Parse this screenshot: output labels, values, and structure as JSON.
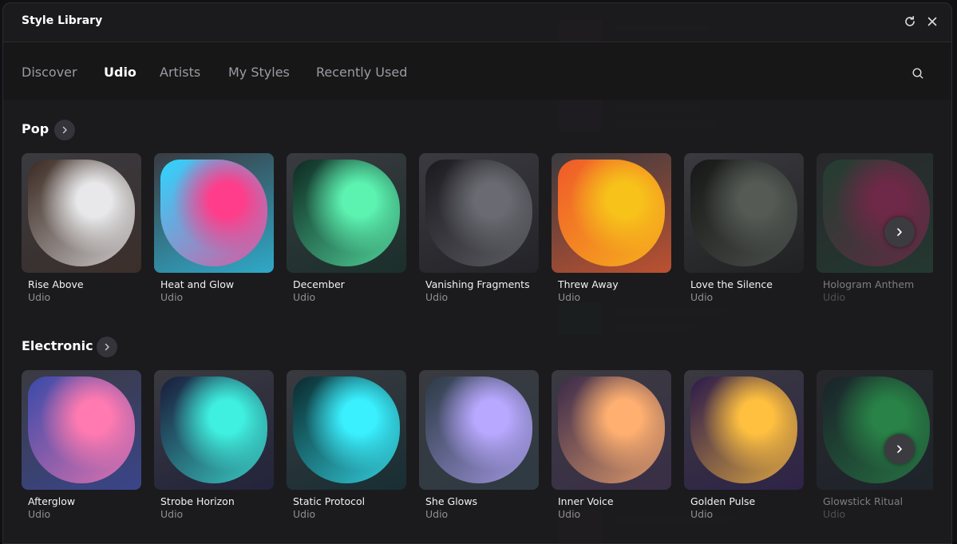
{
  "modal": {
    "title": "Style Library"
  },
  "header_icons": {
    "refresh": "refresh-icon",
    "close": "close-icon"
  },
  "tabs": [
    {
      "label": "Discover",
      "active": false
    },
    {
      "label": "Udio",
      "active": true
    },
    {
      "label": "Artists",
      "active": false
    },
    {
      "label": "My Styles",
      "active": false
    },
    {
      "label": "Recently Used",
      "active": false
    }
  ],
  "sections": [
    {
      "title": "Pop",
      "cards": [
        {
          "name": "Rise Above",
          "sub": "Udio",
          "colors": [
            "#e8e8ea",
            "#3b2a22"
          ]
        },
        {
          "name": "Heat and Glow",
          "sub": "Udio",
          "colors": [
            "#ff3d8a",
            "#2bd6ff"
          ]
        },
        {
          "name": "December",
          "sub": "Udio",
          "colors": [
            "#5cf2b0",
            "#0e2a22"
          ]
        },
        {
          "name": "Vanishing Fragments",
          "sub": "Udio",
          "colors": [
            "#6a6a72",
            "#1a1a1e"
          ]
        },
        {
          "name": "Threw Away",
          "sub": "Udio",
          "colors": [
            "#f7c31a",
            "#f05a2a"
          ]
        },
        {
          "name": "Love the Silence",
          "sub": "Udio",
          "colors": [
            "#555a55",
            "#161716"
          ]
        },
        {
          "name": "Hologram Anthem",
          "sub": "Udio",
          "colors": [
            "#d23a7a",
            "#2a6a4a"
          ]
        }
      ]
    },
    {
      "title": "Electronic",
      "cards": [
        {
          "name": "Afterglow",
          "sub": "Udio",
          "colors": [
            "#ff7ab0",
            "#3a4aa8"
          ]
        },
        {
          "name": "Strobe Horizon",
          "sub": "Udio",
          "colors": [
            "#3ff0e0",
            "#1a1a3a"
          ]
        },
        {
          "name": "Static Protocol",
          "sub": "Udio",
          "colors": [
            "#3af0ff",
            "#0a2a2e"
          ]
        },
        {
          "name": "She Glows",
          "sub": "Udio",
          "colors": [
            "#b8a8ff",
            "#2a3a44"
          ]
        },
        {
          "name": "Inner Voice",
          "sub": "Udio",
          "colors": [
            "#ffb070",
            "#3a2a4a"
          ]
        },
        {
          "name": "Golden Pulse",
          "sub": "Udio",
          "colors": [
            "#ffc040",
            "#2a1a4a"
          ]
        },
        {
          "name": "Glowstick Ritual",
          "sub": "Udio",
          "colors": [
            "#3aff7a",
            "#1a2a3a"
          ]
        }
      ]
    }
  ]
}
